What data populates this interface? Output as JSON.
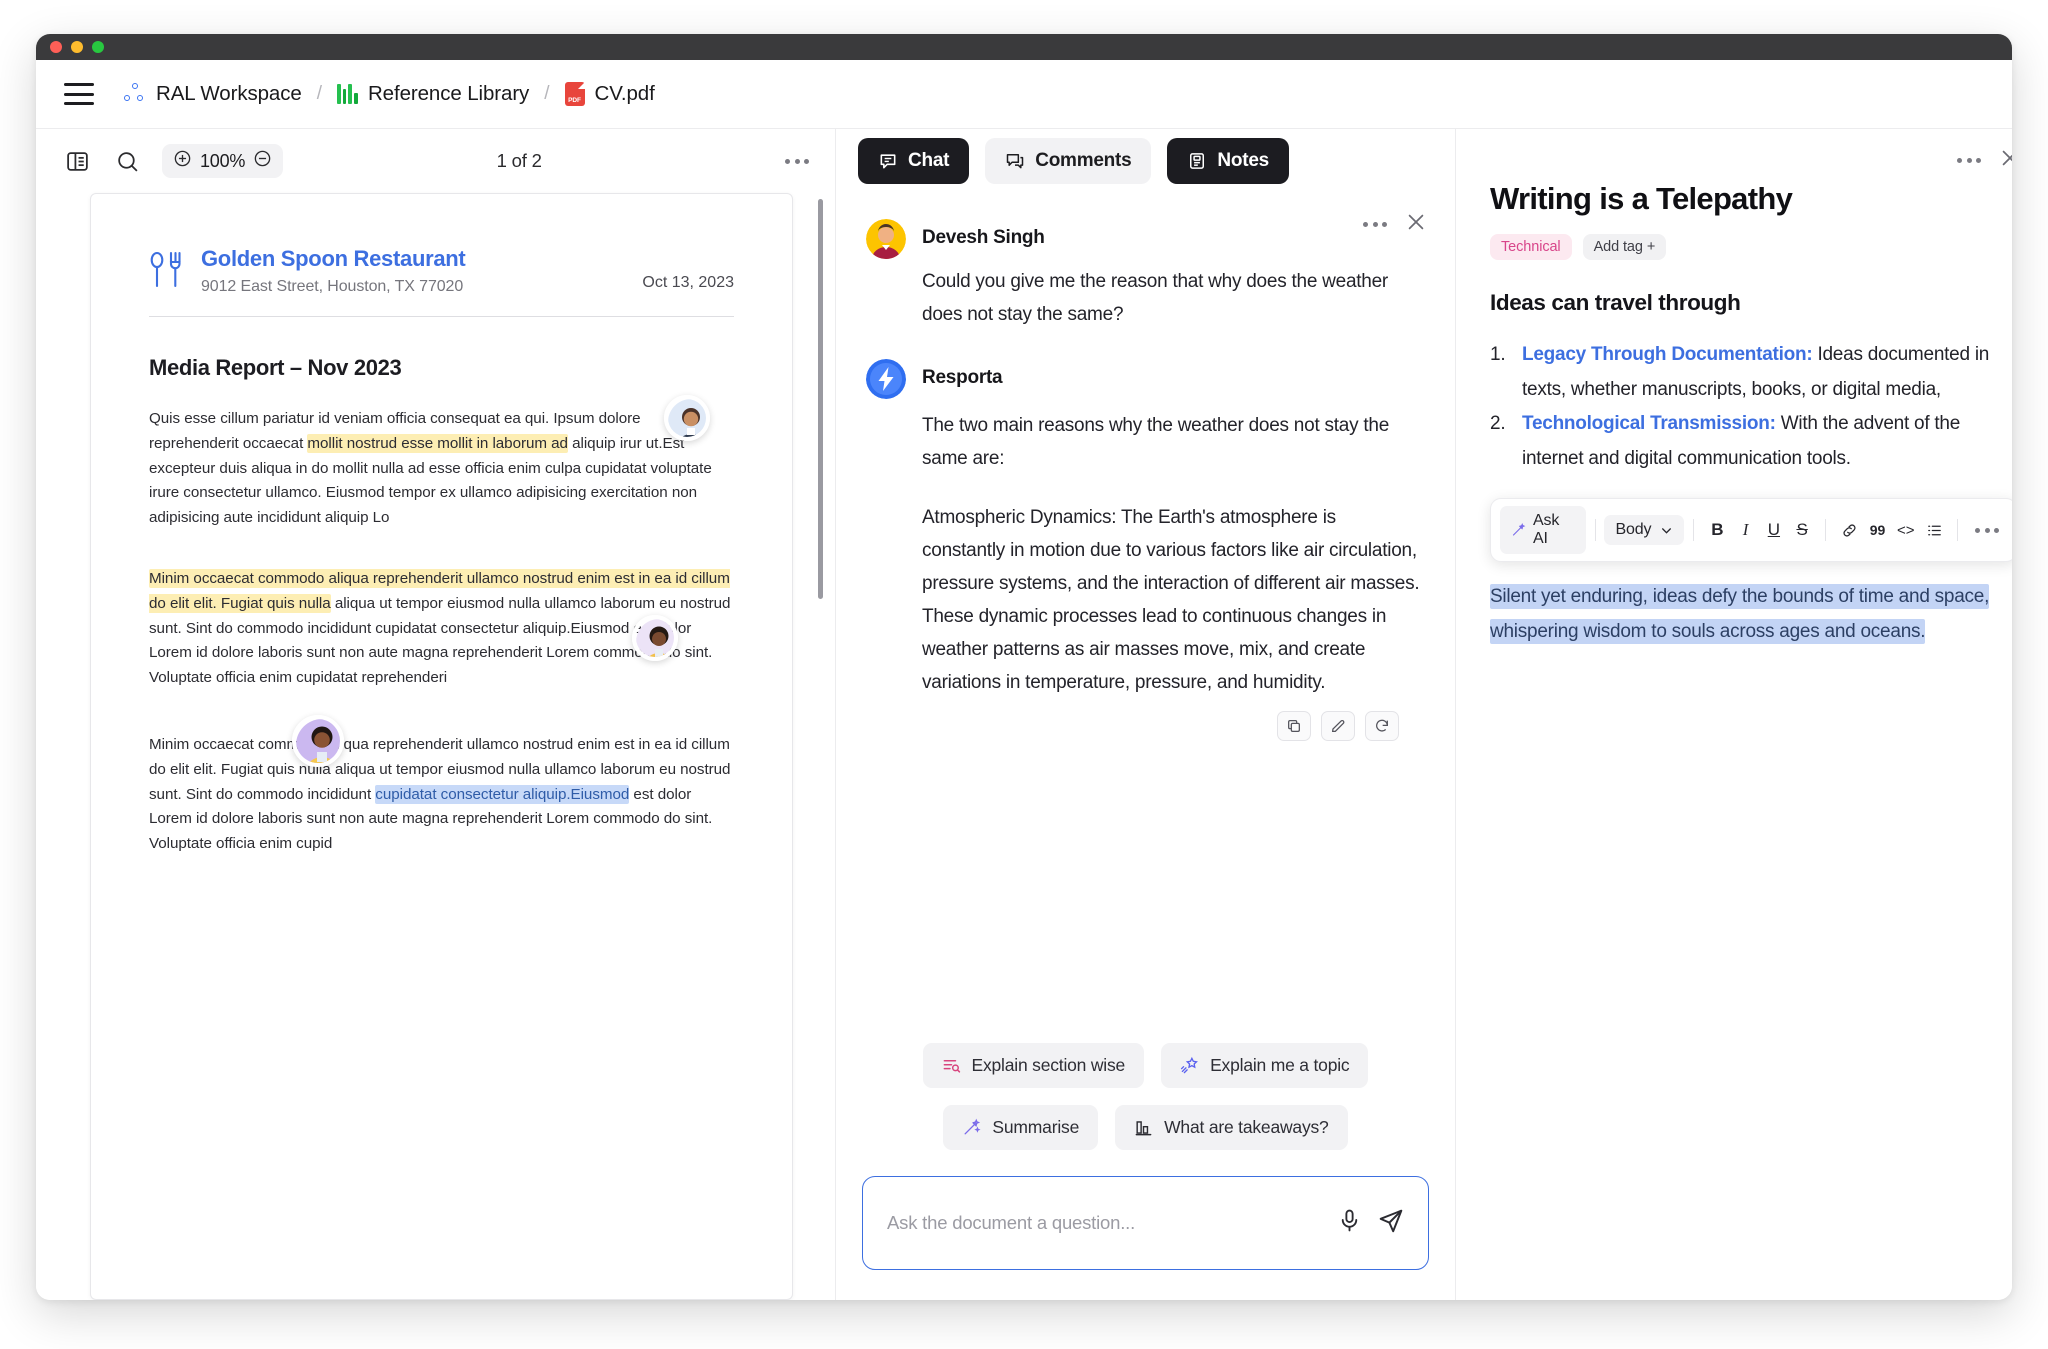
{
  "window": {
    "traffic_lights": [
      "close",
      "minimize",
      "maximize"
    ]
  },
  "breadcrumb": {
    "menu_icon": "hamburger-menu-icon",
    "items": [
      {
        "label": "RAL Workspace",
        "icon": "workspace-dots-icon"
      },
      {
        "label": "Reference Library",
        "icon": "books-icon"
      },
      {
        "label": "CV.pdf",
        "icon": "pdf-file-icon"
      }
    ],
    "separator": "/"
  },
  "pdf_toolbar": {
    "sidebar_icon": "panel-layout-icon",
    "search_icon": "search-icon",
    "zoom_in_icon": "zoom-in-icon",
    "zoom_out_icon": "zoom-out-icon",
    "zoom_level": "100%",
    "page_indicator": "1 of 2",
    "more_icon": "more-horizontal-icon"
  },
  "document": {
    "letterhead": {
      "icon": "cutlery-icon",
      "name": "Golden Spoon Restaurant",
      "address": "9012 East Street, Houston, TX 77020",
      "date": "Oct 13, 2023"
    },
    "heading": "Media Report – Nov 2023",
    "paragraph1": {
      "before": "Quis esse cillum pariatur id veniam officia consequat ea qui. Ipsum dolore reprehenderit occaecat ",
      "highlight": "mollit nostrud esse mollit in laborum ad",
      "after": " aliquip irur ut.Est excepteur duis aliqua in do mollit nulla ad esse officia enim culpa cupidatat voluptate irure consectetur ullamco. Eiusmod tempor ex ullamco adipisicing exercitation non adipisicing aute incididunt aliquip Lo"
    },
    "paragraph2": {
      "highlight": "Minim occaecat commodo aliqua reprehenderit ullamco nostrud enim est in ea id cillum do elit elit. Fugiat quis nulla",
      "after": " aliqua ut tempor eiusmod nulla ullamco laborum eu nostrud sunt. Sint do commodo incididunt cupidatat consectetur aliquip.Eiusmod est dolor Lorem id dolore laboris sunt non aute magna reprehenderit Lorem commodo do sint. Voluptate officia enim cupidatat reprehenderi"
    },
    "paragraph3": {
      "before": "Minim occaecat commodo aliqua reprehenderit ullamco nostrud enim est in ea id cillum do elit elit. Fugiat quis nulla aliqua ut tempor eiusmod nulla ullamco laborum eu nostrud sunt. Sint do commodo incididunt ",
      "highlight": "cupidatat consectetur aliquip.Eiusmod",
      "after": " est dolor Lorem id dolore laboris sunt non aute magna reprehenderit Lorem commodo do sint. Voluptate officia enim cupid"
    }
  },
  "panel_tabs": [
    {
      "label": "Chat",
      "icon": "chat-bubble-icon",
      "active": true
    },
    {
      "label": "Comments",
      "icon": "comment-bubble-icon",
      "active": false
    },
    {
      "label": "Notes",
      "icon": "notes-clipboard-icon",
      "active": true
    }
  ],
  "chat": {
    "more_icon": "more-horizontal-icon",
    "close_icon": "close-icon",
    "user": {
      "name": "Devesh Singh",
      "avatar": "user-avatar",
      "message": "Could you give me the reason that why does the weather does not stay the same?"
    },
    "assistant": {
      "name": "Resporta",
      "avatar": "assistant-bolt-avatar",
      "intro": "The two main reasons why the weather does not stay the same are:",
      "body": "Atmospheric Dynamics: The Earth's atmosphere is constantly in motion due to various factors like air circulation, pressure systems, and the interaction of different air masses. These dynamic processes lead to continuous changes in weather patterns as air masses move, mix, and create variations in temperature, pressure, and humidity.",
      "actions": [
        {
          "icon": "copy-icon"
        },
        {
          "icon": "edit-icon"
        },
        {
          "icon": "regenerate-icon"
        }
      ]
    },
    "suggestions": [
      {
        "label": "Explain section wise",
        "icon": "list-search-icon"
      },
      {
        "label": "Explain me a topic",
        "icon": "shooting-star-icon"
      },
      {
        "label": "Summarise",
        "icon": "magic-wand-icon"
      },
      {
        "label": "What are takeaways?",
        "icon": "bar-chart-icon"
      }
    ],
    "composer": {
      "placeholder": "Ask the document a question...",
      "value": "",
      "mic_icon": "microphone-icon",
      "send_icon": "send-icon"
    }
  },
  "notes": {
    "more_icon": "more-horizontal-icon",
    "close_icon": "close-icon",
    "title": "Writing is a Telepathy",
    "tags": [
      {
        "label": "Technical",
        "color": "#d8458a"
      },
      {
        "label": "Add tag",
        "suffix": "+"
      }
    ],
    "subheading": "Ideas can travel through",
    "list": [
      {
        "num": "1.",
        "bold": "Legacy Through Documentation:",
        "text": " Ideas documented in texts, whether manuscripts, books, or digital media,"
      },
      {
        "num": "2.",
        "bold": "Technological Transmission:",
        "text": " With the advent of the internet and digital communication tools."
      }
    ],
    "format_toolbar": {
      "ask_ai": "Ask AI",
      "ask_ai_icon": "magic-wand-icon",
      "style": "Body",
      "style_chevron_icon": "chevron-down-icon",
      "bold": "B",
      "italic": "I",
      "underline": "U",
      "strike": "S",
      "link_icon": "link-icon",
      "quote": "99",
      "code": "<>",
      "list_icon": "bullet-list-icon",
      "more_icon": "more-horizontal-icon"
    },
    "selected_text": "Silent yet enduring, ideas defy the bounds of time and space, whispering wisdom to souls across ages and oceans.",
    "selection_color": "#c3d4f5"
  },
  "colors": {
    "accent_blue": "#3d6fe0",
    "highlight_yellow": "#fdeeb4",
    "highlight_blue": "#c7d9f8",
    "dark_chip": "#1c1c21",
    "pdf_red": "#e8453c",
    "books_green": "#25c04f"
  }
}
